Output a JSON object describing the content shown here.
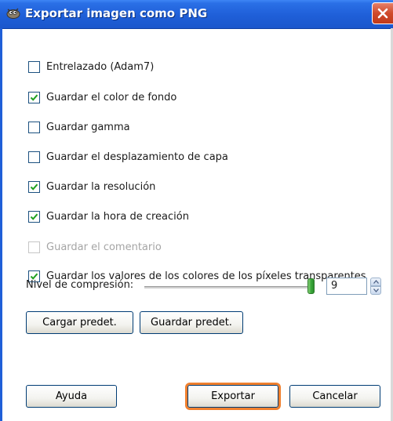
{
  "window": {
    "title": "Exportar imagen como PNG",
    "app_icon": "gimp-wilber-icon",
    "close_icon": "close-icon",
    "accent_color": "#1f5fd8"
  },
  "options": [
    {
      "label": "Entrelazado (Adam7)",
      "checked": false,
      "enabled": true
    },
    {
      "label": "Guardar el color de fondo",
      "checked": true,
      "enabled": true
    },
    {
      "label": "Guardar gamma",
      "checked": false,
      "enabled": true
    },
    {
      "label": "Guardar el desplazamiento de capa",
      "checked": false,
      "enabled": true
    },
    {
      "label": "Guardar la resolución",
      "checked": true,
      "enabled": true
    },
    {
      "label": "Guardar la hora de creación",
      "checked": true,
      "enabled": true
    },
    {
      "label": "Guardar el comentario",
      "checked": false,
      "enabled": false
    },
    {
      "label": "Guardar los valores de los colores de los píxeles transparentes",
      "checked": true,
      "enabled": true
    }
  ],
  "compression": {
    "label": "Nivel de compresión:",
    "value": "9",
    "slider_fraction": 1.0
  },
  "buttons": {
    "load_defaults": "Cargar predet.",
    "save_defaults": "Guardar predet.",
    "help": "Ayuda",
    "export": "Exportar",
    "cancel": "Cancelar"
  },
  "colors": {
    "check_mark": "#21a121",
    "default_button_highlight": "#f0802e"
  }
}
